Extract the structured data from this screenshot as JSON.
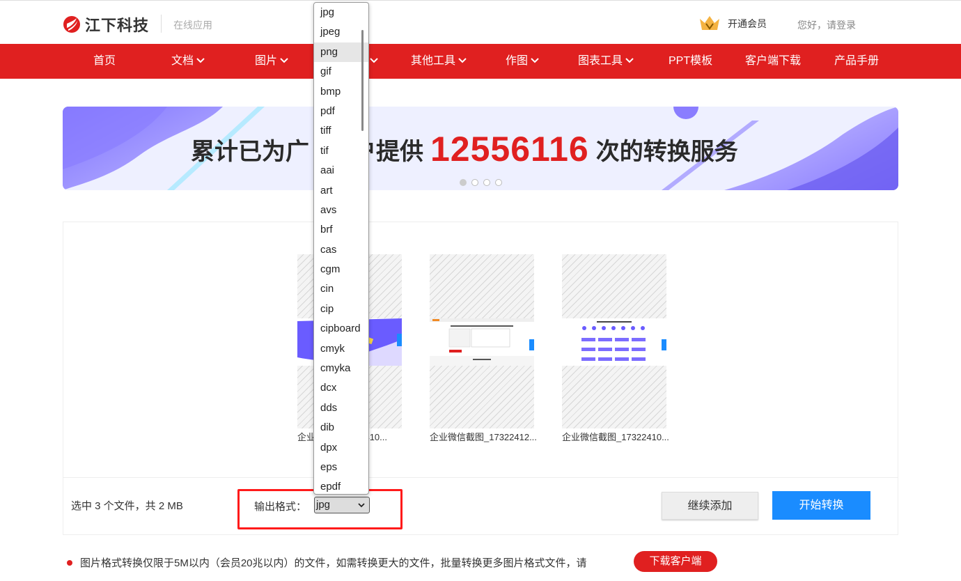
{
  "header": {
    "logo_text": "江下科技",
    "sub_title": "在线应用",
    "vip_label": "开通会员",
    "login_label": "您好，请登录"
  },
  "nav": {
    "items": [
      {
        "label": "首页"
      },
      {
        "label": "文档"
      },
      {
        "label": "图片"
      },
      {
        "label": ""
      },
      {
        "label": "其他工具"
      },
      {
        "label": "作图"
      },
      {
        "label": "图表工具"
      },
      {
        "label": "PPT模板"
      },
      {
        "label": "客户端下载"
      },
      {
        "label": "产品手册"
      }
    ]
  },
  "banner": {
    "text_before": "累计已为广",
    "text_mid": "户提供",
    "count": "12556116",
    "text_after": "次的转换服务"
  },
  "files": [
    {
      "name": "企业"
    },
    {
      "name": "企业微信截图_17322412..."
    },
    {
      "name": "企业微信截图_17322410..."
    }
  ],
  "files_extra_name": "22410...",
  "toolbar": {
    "status": "选中 3 个文件，共 2 MB",
    "format_label": "输出格式：",
    "format_value": "jpg",
    "add_button": "继续添加",
    "start_button": "开始转换"
  },
  "notice": {
    "text": "图片格式转换仅限于5M以内（会员20兆以内）的文件，如需转换更大的文件，批量转换更多图片格式文件，请",
    "download_button": "下载客户端"
  },
  "dropdown": {
    "options": [
      "jpg",
      "jpeg",
      "png",
      "gif",
      "bmp",
      "pdf",
      "tiff",
      "tif",
      "aai",
      "art",
      "avs",
      "brf",
      "cas",
      "cgm",
      "cin",
      "cip",
      "cipboard",
      "cmyk",
      "cmyka",
      "dcx",
      "dds",
      "dib",
      "dpx",
      "eps",
      "epdf"
    ],
    "highlighted": "png"
  },
  "colors": {
    "brand_red": "#e02020",
    "primary_blue": "#1a8cff",
    "highlight_box": "#ff1a1a"
  }
}
